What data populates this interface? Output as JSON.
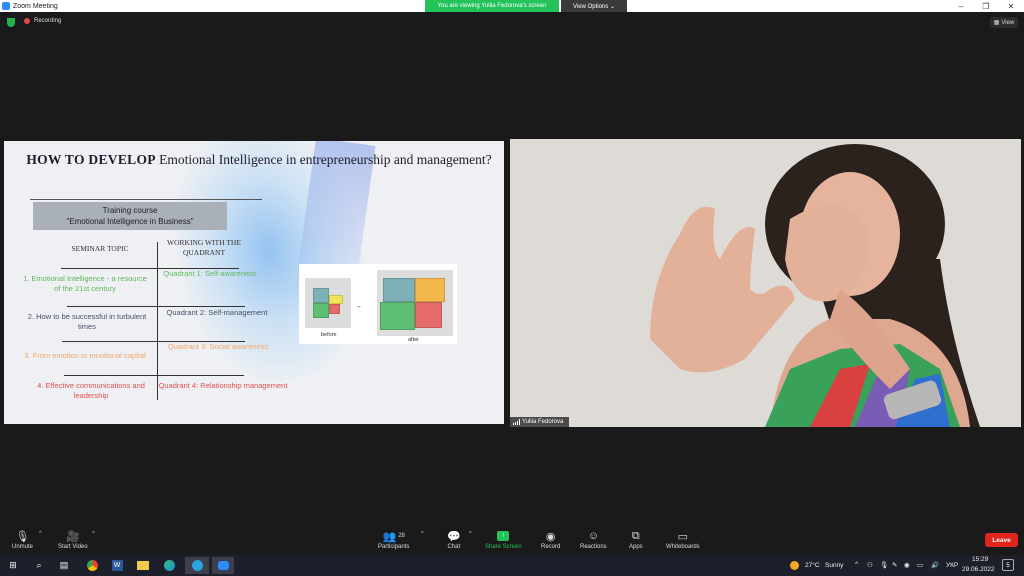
{
  "window": {
    "title": "Zoom Meeting"
  },
  "banner": {
    "viewing": "You are viewing Yuliia Fedorova's screen",
    "view_options": "View Options ⌄"
  },
  "top": {
    "recording": "Recording",
    "view": "View"
  },
  "slide": {
    "title_bold": "HOW TO DEVELOP",
    "title_rest": " Emotional Intelligence in entrepreneurship and management?",
    "course_line1": "Training course",
    "course_line2": "\"Emotional Intelligence in Business\"",
    "col_topic": "SEMINAR TOPIC",
    "col_quadrant": "WORKING WITH THE QUADRANT",
    "rows": [
      {
        "topic": "1. Emotional Intelligence - a resource of the 21st century",
        "quadrant": "Quadrant 1: Self-awareness",
        "color": "#5fb85a"
      },
      {
        "topic": "2. How to be successful in turbulent times",
        "quadrant": "Quadrant 2: Self-management",
        "color": "#4a4d66"
      },
      {
        "topic": "3. From emotion to emotional capital",
        "quadrant": "Quadrant 3: Social awareness",
        "color": "#f0a96a"
      },
      {
        "topic": "4. Effective communications and leadership",
        "quadrant": "Quadrant 4: Relationship management",
        "color": "#e0524d"
      }
    ],
    "fig_before": "before",
    "fig_after": "after"
  },
  "video": {
    "name": "Yuliia Fedorova"
  },
  "toolbar": {
    "unmute": "Unmute",
    "start_video": "Start Video",
    "participants": "Participants",
    "participants_count": "28",
    "chat": "Chat",
    "share_screen": "Share Screen",
    "record": "Record",
    "reactions": "Reactions",
    "apps": "Apps",
    "whiteboards": "Whiteboards",
    "leave": "Leave"
  },
  "taskbar": {
    "weather_temp": "27°C",
    "weather_text": "Sunny",
    "lang": "УКР",
    "time": "15:29",
    "date": "29.06.2022",
    "notifications": "5"
  },
  "colors": {
    "accent_green": "#23c35a",
    "leave_red": "#e0251c",
    "zoom_blue": "#2d8cff"
  }
}
